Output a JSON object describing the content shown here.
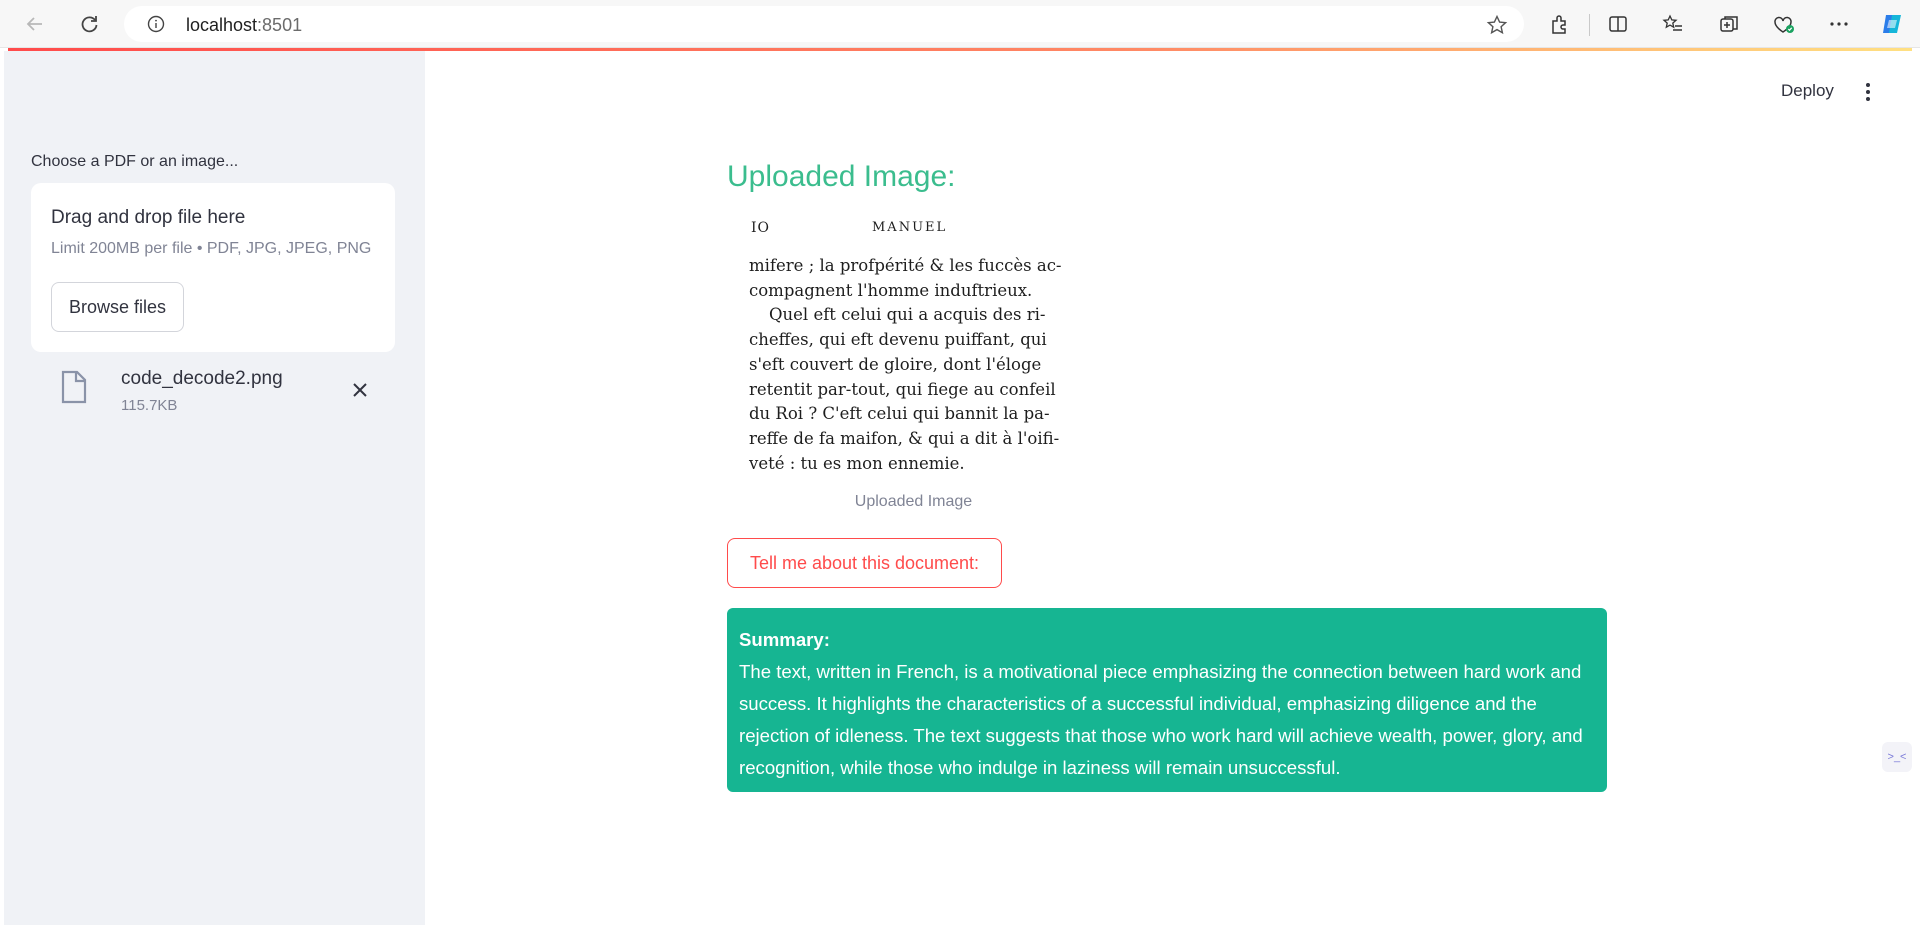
{
  "browser": {
    "url_host": "localhost",
    "url_port": ":8501",
    "icons": [
      "back-icon",
      "refresh-icon",
      "info-icon",
      "star-icon",
      "extensions-icon",
      "split-screen-icon",
      "favorites-icon",
      "collections-icon",
      "browser-essentials-icon",
      "more-icon",
      "copilot-icon"
    ]
  },
  "header": {
    "deploy_label": "Deploy"
  },
  "sidebar": {
    "uploader_label": "Choose a PDF or an image...",
    "dropzone_title": "Drag and drop file here",
    "dropzone_limit": "Limit 200MB per file • PDF, JPG, JPEG, PNG",
    "browse_label": "Browse files",
    "file": {
      "name": "code_decode2.png",
      "size": "115.7KB"
    }
  },
  "main": {
    "heading": "Uploaded Image:",
    "document": {
      "page_number": "IO",
      "running_head": "MANUEL",
      "lines": [
        "mifere ; la profpérité & les fuccès ac-",
        "compagnent l'homme induftrieux.",
        "Quel eft celui qui a acquis des ri-",
        "cheffes, qui eft devenu puiffant, qui",
        "s'eft couvert de gloire, dont l'éloge",
        "retentit par-tout, qui fiege au confeil",
        "du Roi ? C'eft celui qui bannit la pa-",
        "reffe de fa maifon, & qui a dit à l'oifi-",
        "veté : tu es mon ennemie."
      ]
    },
    "image_caption": "Uploaded Image",
    "ask_button_label": "Tell me about this document:",
    "summary": {
      "title": "Summary:",
      "text": "The text, written in French, is a motivational piece emphasizing the connection between hard work and success. It highlights the characteristics of a successful individual, emphasizing diligence and the rejection of idleness. The text suggests that those who work hard will achieve wealth, power, glory, and recognition, while those who indulge in laziness will remain unsuccessful."
    }
  },
  "colors": {
    "heading": "#3bbd8e",
    "summary_bg": "#16b592",
    "primary": "#ff4b4b",
    "sidebar_bg": "#f0f2f6"
  }
}
